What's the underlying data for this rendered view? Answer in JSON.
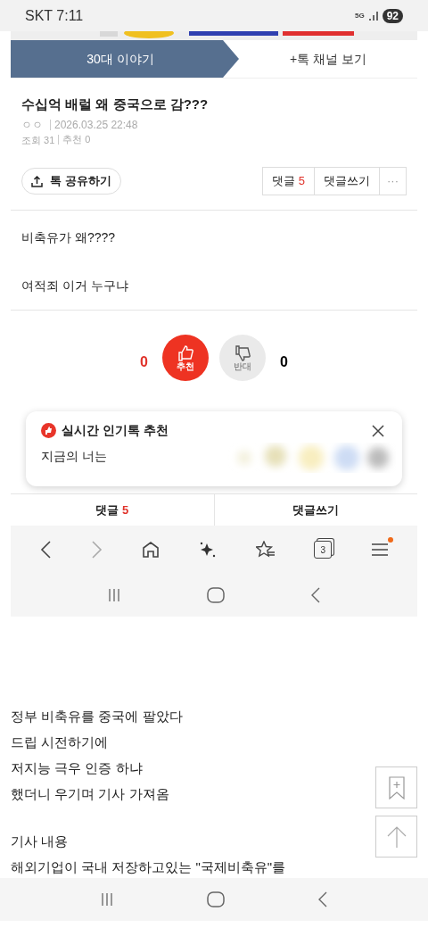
{
  "status_bar": {
    "carrier": "SKT",
    "time": "7:11",
    "network": "5G",
    "battery": "92"
  },
  "board_tabs": [
    {
      "label": "30대 이야기",
      "selected": true
    },
    {
      "label": "+톡 채널 보기",
      "selected": false
    }
  ],
  "post": {
    "title": "수십억 배럴 왜 중국으로 감???",
    "author": "ㅇㅇ",
    "date": "2026.03.25 22:48",
    "views": "조회 31",
    "recommends": "추천 0"
  },
  "actions": {
    "share": "톡 공유하기",
    "comments_label": "댓글",
    "comments_count": "5",
    "write": "댓글쓰기",
    "more": "···"
  },
  "body": [
    "비축유가 왜????",
    "여적죄 이거 누구냐"
  ],
  "votes": {
    "up_count": "0",
    "up_label": "추천",
    "down_label": "반대",
    "down_count": "0"
  },
  "popup": {
    "title": "실시간 인기톡 추천",
    "text": "지금의 너는"
  },
  "comment_bar": {
    "comments_label": "댓글",
    "comments_count": "5",
    "write": "댓글쓰기"
  },
  "browser_toolbar": {
    "tab_count": "3",
    "menu_notification": true
  },
  "page_text": [
    {
      "lines": [
        "정부 비축유를 중국에 팔았다",
        "드립 시전하기에",
        "저지능 극우 인증 하냐",
        "했더니 우기며 기사 가져옴"
      ]
    },
    {
      "lines": [
        "기사 내용",
        "해외기업이 국내 저장하고있는 \"국제비축유\"를"
      ]
    }
  ]
}
